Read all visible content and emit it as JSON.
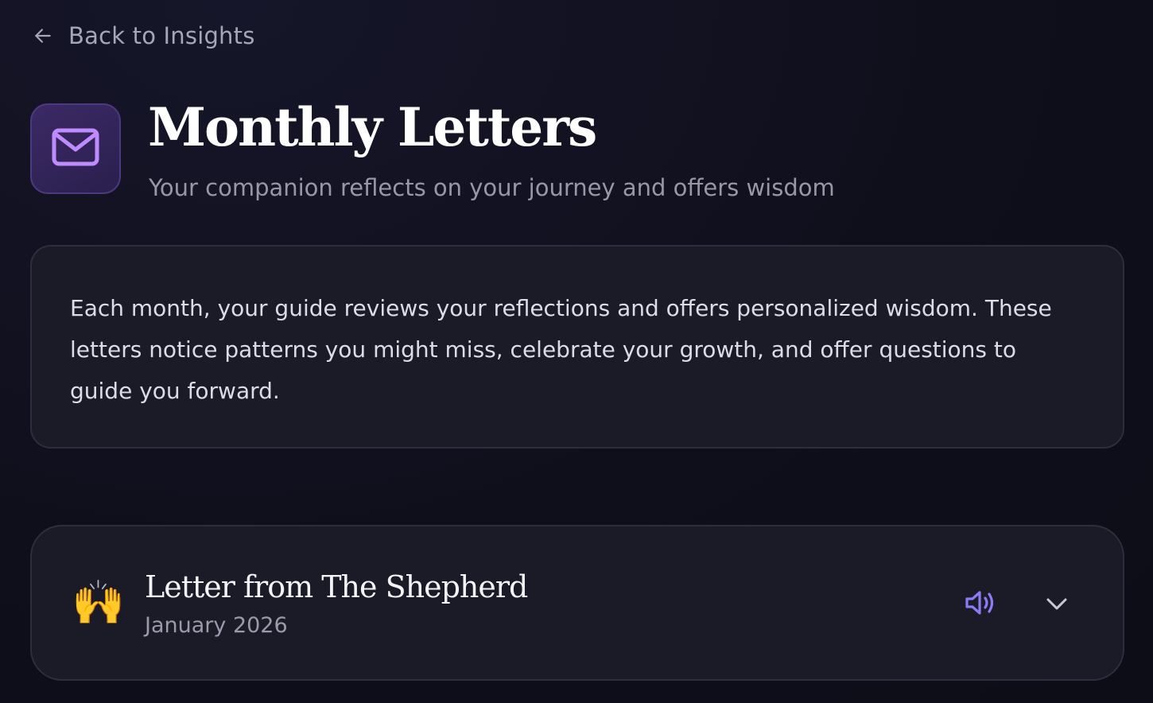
{
  "nav": {
    "back_label": "Back to Insights",
    "back_icon": "arrow-left-icon"
  },
  "header": {
    "icon": "mail-icon",
    "title": "Monthly Letters",
    "subtitle": "Your companion reflects on your journey and offers wisdom"
  },
  "intro": {
    "text": "Each month, your guide reviews your reflections and offers personalized wisdom. These letters notice patterns you might miss, celebrate your growth, and offer questions to guide you forward."
  },
  "letters": [
    {
      "emoji": "🙌",
      "title": "Letter from The Shepherd",
      "date": "January 2026",
      "audio_icon": "speaker-icon",
      "expand_icon": "chevron-down-icon"
    }
  ],
  "colors": {
    "background": "#0f0f1c",
    "card": "#1b1b28",
    "accent": "#8b7cf6",
    "icon_box": "#2f2356"
  }
}
